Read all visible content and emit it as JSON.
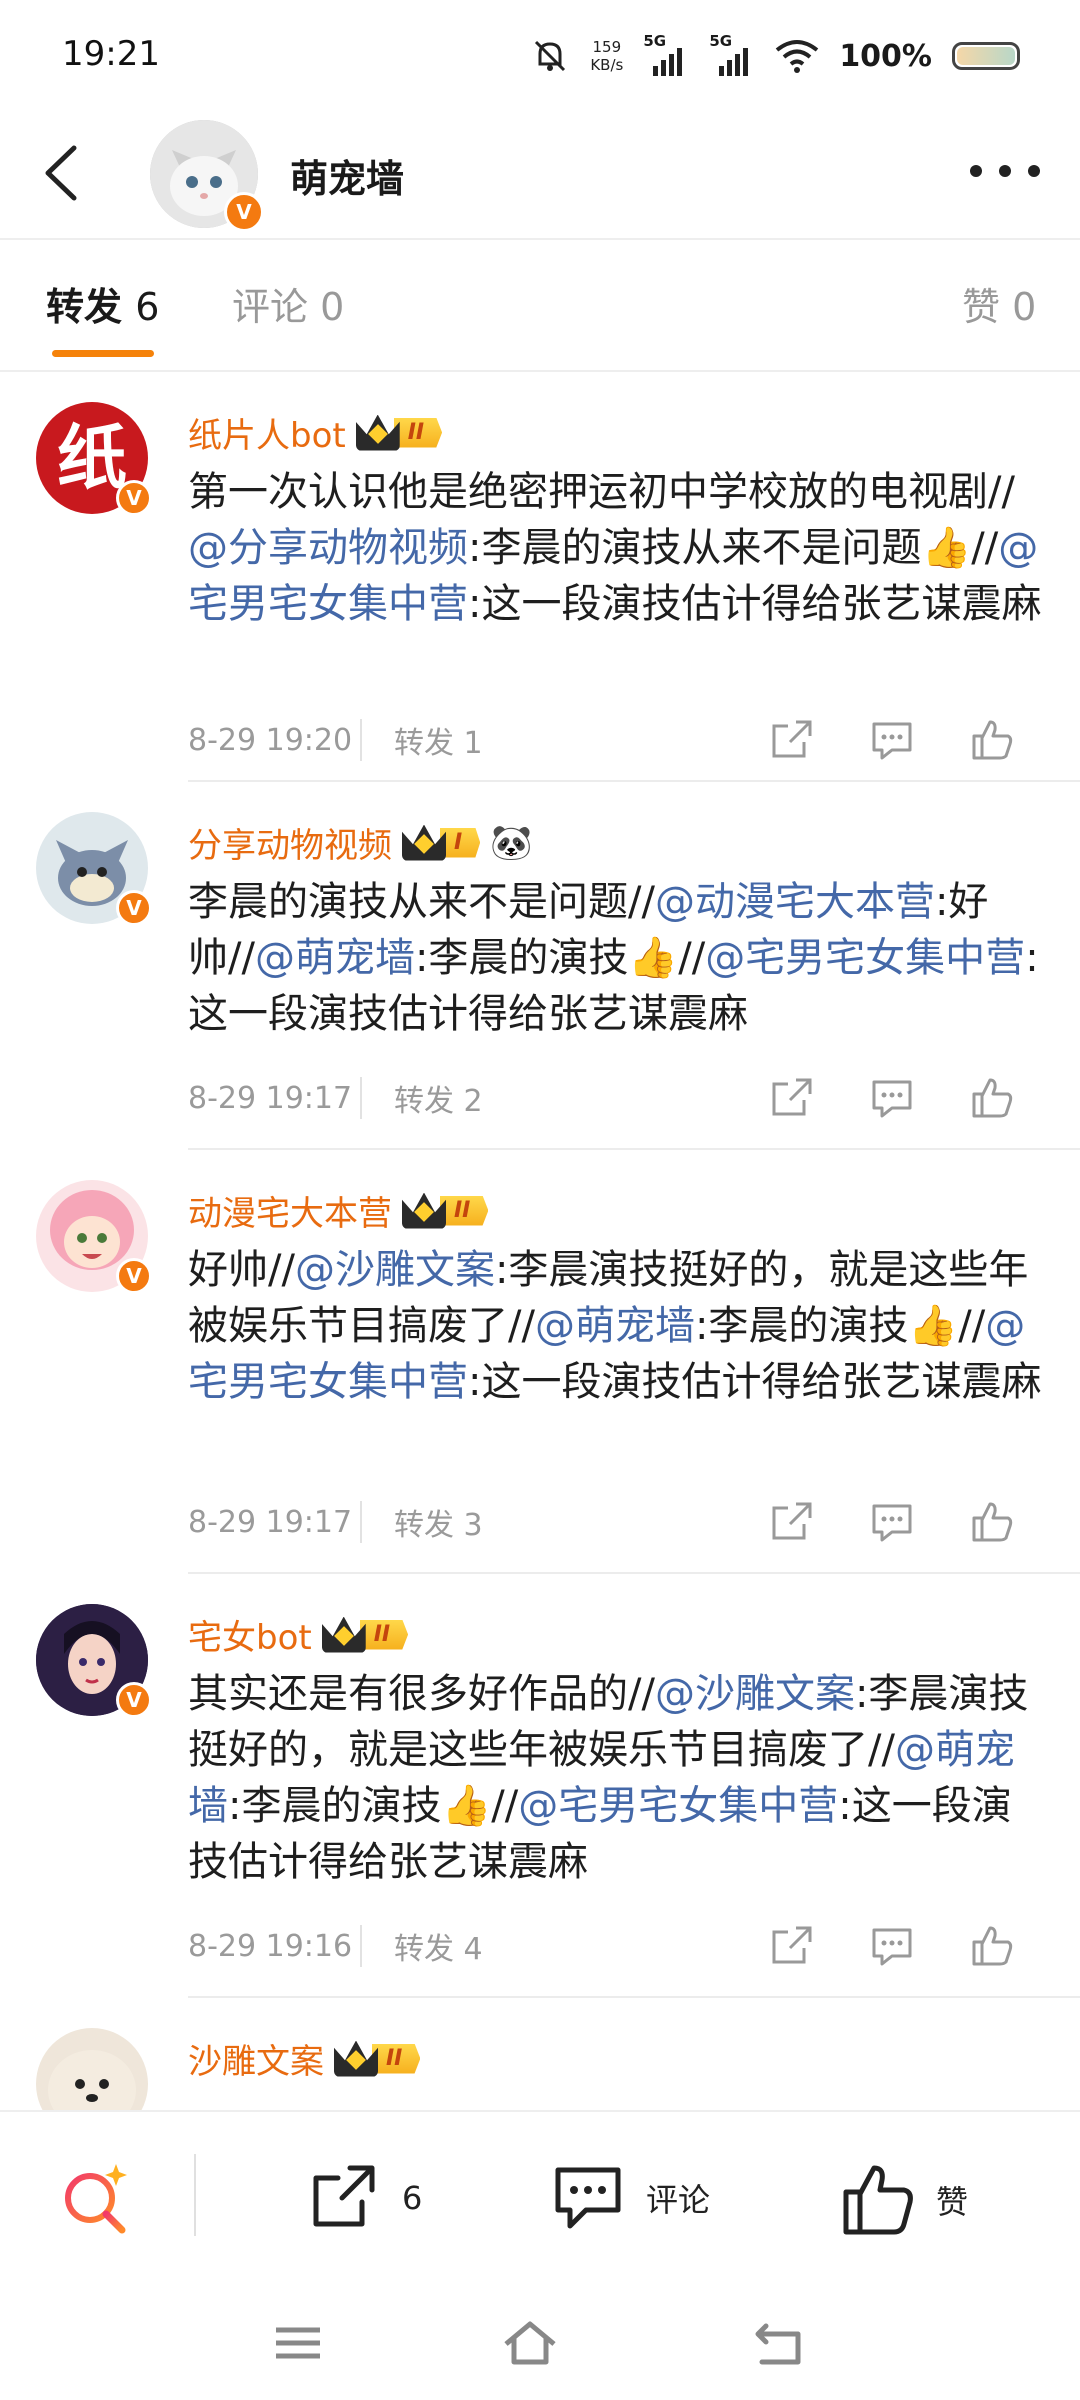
{
  "status_bar": {
    "time": "19:21",
    "speed_value": "159",
    "speed_unit": "KB/s",
    "net1": "5G",
    "net2": "5G",
    "battery": "100%"
  },
  "header": {
    "title": "萌宠墙",
    "verified_badge": "V"
  },
  "tabs": {
    "forward": "转发",
    "forward_count": "6",
    "comment": "评论",
    "comment_count": "0",
    "like": "赞",
    "like_count": "0"
  },
  "posts": [
    {
      "name": "纸片人bot",
      "level": "II",
      "avatar_char": "纸",
      "text_segments": [
        {
          "t": "第一次认识他是绝密押运初中学校放的电视剧//",
          "m": false
        },
        {
          "t": "@分享动物视频",
          "m": true
        },
        {
          "t": ":李晨的演技从来不是问题👍//",
          "m": false
        },
        {
          "t": "@宅男宅女集中营",
          "m": true
        },
        {
          "t": ":这一段演技估计得给张艺谋震麻",
          "m": false
        }
      ],
      "time": "8-29  19:20",
      "forward_label": "转发 1"
    },
    {
      "name": "分享动物视频",
      "level": "I",
      "extra_icon": "🐼",
      "text_segments": [
        {
          "t": "李晨的演技从来不是问题//",
          "m": false
        },
        {
          "t": "@动漫宅大本营",
          "m": true
        },
        {
          "t": ":好帅//",
          "m": false
        },
        {
          "t": "@萌宠墙",
          "m": true
        },
        {
          "t": ":李晨的演技👍//",
          "m": false
        },
        {
          "t": "@宅男宅女集中营",
          "m": true
        },
        {
          "t": ":这一段演技估计得给张艺谋震麻",
          "m": false
        }
      ],
      "time": "8-29  19:17",
      "forward_label": "转发 2"
    },
    {
      "name": "动漫宅大本营",
      "level": "II",
      "text_segments": [
        {
          "t": "好帅//",
          "m": false
        },
        {
          "t": "@沙雕文案",
          "m": true
        },
        {
          "t": ":李晨演技挺好的，就是这些年被娱乐节目搞废了//",
          "m": false
        },
        {
          "t": "@萌宠墙",
          "m": true
        },
        {
          "t": ":李晨的演技👍//",
          "m": false
        },
        {
          "t": "@宅男宅女集中营",
          "m": true
        },
        {
          "t": ":这一段演技估计得给张艺谋震麻",
          "m": false
        }
      ],
      "time": "8-29  19:17",
      "forward_label": "转发 3"
    },
    {
      "name": "宅女bot",
      "level": "II",
      "text_segments": [
        {
          "t": "其实还是有很多好作品的//",
          "m": false
        },
        {
          "t": "@沙雕文案",
          "m": true
        },
        {
          "t": ":李晨演技挺好的，就是这些年被娱乐节目搞废了//",
          "m": false
        },
        {
          "t": "@萌宠墙",
          "m": true
        },
        {
          "t": ":李晨的演技👍//",
          "m": false
        },
        {
          "t": "@宅男宅女集中营",
          "m": true
        },
        {
          "t": ":这一段演技估计得给张艺谋震麻",
          "m": false
        }
      ],
      "time": "8-29  19:16",
      "forward_label": "转发 4"
    },
    {
      "name": "沙雕文案",
      "level": "II"
    }
  ],
  "bottom_bar": {
    "forward_count": "6",
    "comment_label": "评论",
    "like_label": "赞"
  },
  "colors": {
    "accent": "#f5820a",
    "username": "#e86b10",
    "mention": "#4468a8",
    "verified": "#f47a10"
  }
}
